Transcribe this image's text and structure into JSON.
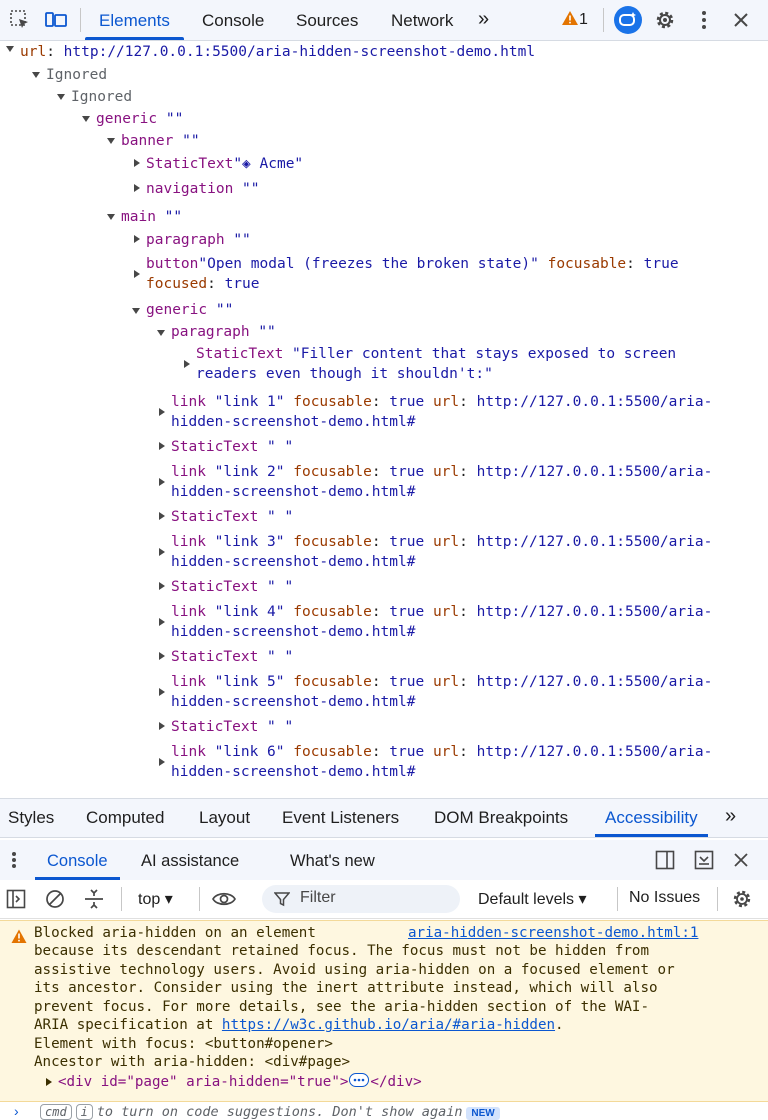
{
  "toolbar": {
    "tabs": [
      "Elements",
      "Console",
      "Sources",
      "Network"
    ],
    "more": "»",
    "warning_count": "1"
  },
  "tree": {
    "root_prop": "url",
    "root_url": "http://127.0.0.1:5500/aria-hidden-screenshot-demo.html",
    "ignored1": "Ignored",
    "ignored2": "Ignored",
    "generic1_role": "generic",
    "empty": "\"\"",
    "banner_role": "banner",
    "statictext_role": "StaticText",
    "banner_text": "\"◈ Acme\"",
    "navigation_role": "navigation",
    "main_role": "main",
    "paragraph_role": "paragraph",
    "button_role": "button",
    "button_name": "\"Open modal (freezes the broken state)\"",
    "focusable_prop": "focusable",
    "focused_prop": "focused",
    "true_val": "true",
    "generic2_role": "generic",
    "filler_line1": "\"Filler content that stays exposed to screen",
    "filler_line2": "readers even though it shouldn't:\"",
    "link_role": "link",
    "url_prop": "url",
    "link_url_line1": "http://127.0.0.1:5500/aria-",
    "link_url_line2": "hidden-screenshot-demo.html#",
    "space_text": "\" \"",
    "links": [
      "\"link 1\"",
      "\"link 2\"",
      "\"link 3\"",
      "\"link 4\"",
      "\"link 5\"",
      "\"link 6\""
    ]
  },
  "subtabs": [
    "Styles",
    "Computed",
    "Layout",
    "Event Listeners",
    "DOM Breakpoints",
    "Accessibility"
  ],
  "subtabs_more": "»",
  "drawer": {
    "tabs": [
      "Console",
      "AI assistance",
      "What's new"
    ]
  },
  "console_toolbar": {
    "context": "top ▾",
    "filter_placeholder": "Filter",
    "levels": "Default levels ▾",
    "issues": "No Issues"
  },
  "warning": {
    "line1": "Blocked aria-hidden on an element",
    "source": "aria-hidden-screenshot-demo.html:1",
    "line2": "because its descendant retained focus. The focus must not be hidden from",
    "line3": "assistive technology users. Avoid using aria-hidden on a focused element or",
    "line4": "its ancestor. Consider using the inert attribute instead, which will also",
    "line5": "prevent focus. For more details, see the aria-hidden section of the WAI-",
    "line6a": "ARIA specification at ",
    "spec_link": "https://w3c.github.io/aria/#aria-hidden",
    "line6b": ".",
    "line7": "Element with focus: <button#opener>",
    "line8": "Ancestor with aria-hidden: <div#page>",
    "node_open": "<div id=\"page\" aria-hidden=\"true\">",
    "node_close": "</div>"
  },
  "prompt": {
    "kbd1": "cmd",
    "kbd2": "i",
    "text": "to turn on code suggestions. Don't show again",
    "badge": "NEW"
  },
  "colors": {
    "accent": "#0b57d0",
    "warning_bg": "#fef7e0",
    "toolbar_bg": "#f3f6fc"
  }
}
